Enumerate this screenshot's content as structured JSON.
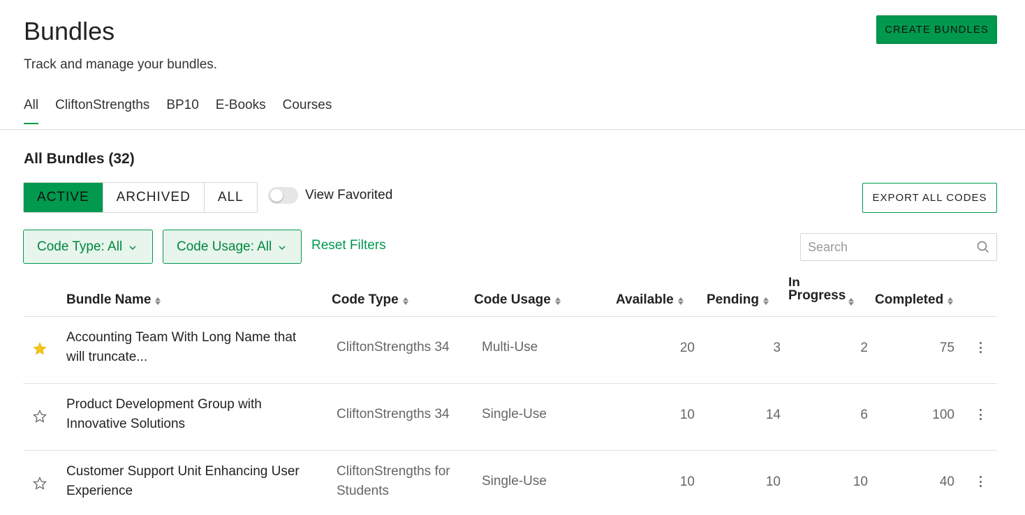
{
  "header": {
    "title": "Bundles",
    "subtitle": "Track and manage your bundles.",
    "create_button": "CREATE BUNDLES"
  },
  "tabs": [
    {
      "label": "All",
      "active": true
    },
    {
      "label": "CliftonStrengths",
      "active": false
    },
    {
      "label": "BP10",
      "active": false
    },
    {
      "label": "E-Books",
      "active": false
    },
    {
      "label": "Courses",
      "active": false
    }
  ],
  "section_title": "All Bundles (32)",
  "status_filter": {
    "options": [
      "ACTIVE",
      "ARCHIVED",
      "ALL"
    ],
    "selected": "ACTIVE"
  },
  "view_favorited": {
    "label": "View Favorited",
    "on": false
  },
  "export_button": "EXPORT ALL CODES",
  "filters": {
    "code_type": "Code Type: All",
    "code_usage": "Code Usage: All",
    "reset": "Reset Filters"
  },
  "search": {
    "placeholder": "Search",
    "value": ""
  },
  "columns": {
    "bundle_name": "Bundle Name",
    "code_type": "Code Type",
    "code_usage": "Code Usage",
    "available": "Available",
    "pending": "Pending",
    "in_progress_line1": "In",
    "in_progress_line2": "Progress",
    "completed": "Completed"
  },
  "rows": [
    {
      "favorite": true,
      "name": "Accounting Team With Long Name that will truncate...",
      "code_type": "CliftonStrengths 34",
      "code_usage": "Multi-Use",
      "available": "20",
      "pending": "3",
      "in_progress": "2",
      "completed": "75"
    },
    {
      "favorite": false,
      "name": "Product Development Group with Innovative Solutions",
      "code_type": "CliftonStrengths 34",
      "code_usage": "Single-Use",
      "available": "10",
      "pending": "14",
      "in_progress": "6",
      "completed": "100"
    },
    {
      "favorite": false,
      "name": "Customer Support Unit Enhancing User Experience",
      "code_type": "CliftonStrengths for Students",
      "code_usage": "Single-Use",
      "available": "10",
      "pending": "10",
      "in_progress": "10",
      "completed": "40"
    }
  ],
  "colors": {
    "accent": "#00994d",
    "favorite_star": "#f5c518",
    "filter_bg": "#e7f5ec"
  },
  "icons": {
    "favorite_on": "star-filled-icon",
    "favorite_off": "star-outline-icon",
    "search": "search-icon",
    "row_menu": "kebab-menu-icon",
    "sort": "sort-icon",
    "dropdown": "chevron-down-icon"
  }
}
